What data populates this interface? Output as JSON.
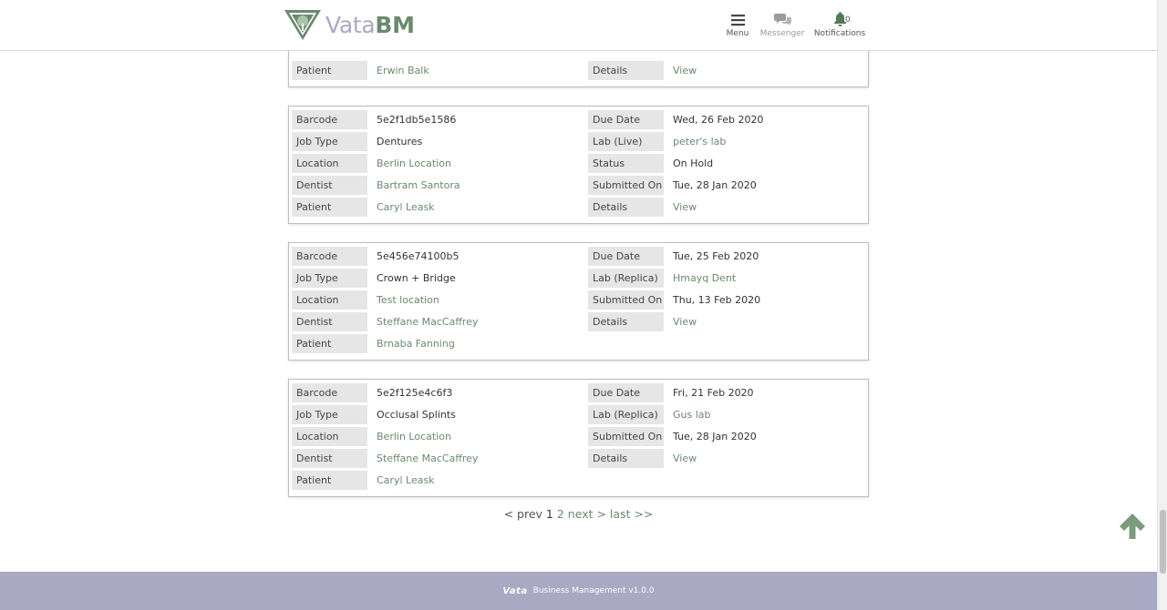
{
  "header": {
    "logo_text_light": "Vata",
    "logo_text_bold": "BM",
    "nav": {
      "menu_label": "Menu",
      "messenger_label": "Messenger",
      "notifications_label": "Notifications",
      "notifications_count": "0"
    }
  },
  "partial_card": {
    "left_label": "Patient",
    "left_value": "Erwin Balk",
    "right_label": "Details",
    "right_value": "View"
  },
  "cards": [
    {
      "barcode_label": "Barcode",
      "barcode": "5e2f1db5e1586",
      "jobtype_label": "Job Type",
      "jobtype": "Dentures",
      "location_label": "Location",
      "location": "Berlin Location",
      "dentist_label": "Dentist",
      "dentist": "Bartram Santora",
      "patient_label": "Patient",
      "patient": "Caryl Leask",
      "due_label": "Due Date",
      "due": "Wed, 26 Feb 2020",
      "lab_label": "Lab (Live)",
      "lab": "peter's lab",
      "status_label": "Status",
      "status": "On Hold",
      "submitted_label": "Submitted On",
      "submitted": "Tue, 28 Jan 2020",
      "details_label": "Details",
      "details": "View"
    },
    {
      "barcode_label": "Barcode",
      "barcode": "5e456e74100b5",
      "jobtype_label": "Job Type",
      "jobtype": "Crown + Bridge",
      "location_label": "Location",
      "location": "Test location",
      "dentist_label": "Dentist",
      "dentist": "Steffane MacCaffrey",
      "patient_label": "Patient",
      "patient": "Brnaba Fanning",
      "due_label": "Due Date",
      "due": "Tue, 25 Feb 2020",
      "lab_label": "Lab (Replica)",
      "lab": "Hmayq Dent",
      "submitted_label": "Submitted On",
      "submitted": "Thu, 13 Feb 2020",
      "details_label": "Details",
      "details": "View"
    },
    {
      "barcode_label": "Barcode",
      "barcode": "5e2f125e4c6f3",
      "jobtype_label": "Job Type",
      "jobtype": "Occlusal Splints",
      "location_label": "Location",
      "location": "Berlin Location",
      "dentist_label": "Dentist",
      "dentist": "Steffane MacCaffrey",
      "patient_label": "Patient",
      "patient": "Caryl Leask",
      "due_label": "Due Date",
      "due": "Fri, 21 Feb 2020",
      "lab_label": "Lab (Replica)",
      "lab": "Gus lab",
      "submitted_label": "Submitted On",
      "submitted": "Tue, 28 Jan 2020",
      "details_label": "Details",
      "details": "View"
    }
  ],
  "pagination": {
    "prev": "< prev",
    "current": "1",
    "page2": "2",
    "next": "next >",
    "last": "last >>"
  },
  "footer": {
    "brand": "Vata",
    "text": "Business Management v1.0.0"
  },
  "colors": {
    "accent_green": "#6a8a6c",
    "brand_lavender": "#a9a9c4",
    "label_bg": "#e6e6e6"
  }
}
